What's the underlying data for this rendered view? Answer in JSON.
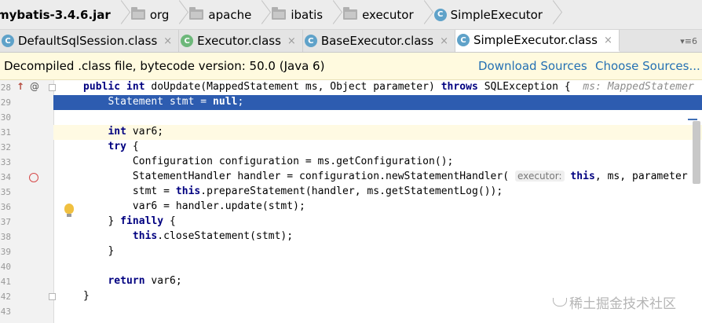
{
  "breadcrumb": {
    "items": [
      {
        "label": "mybatis-3.4.6.jar",
        "icon": "none"
      },
      {
        "label": "org",
        "icon": "folder-icon"
      },
      {
        "label": "apache",
        "icon": "folder-icon"
      },
      {
        "label": "ibatis",
        "icon": "folder-icon"
      },
      {
        "label": "executor",
        "icon": "folder-icon"
      },
      {
        "label": "SimpleExecutor",
        "icon": "class-icon"
      }
    ]
  },
  "tabs": {
    "items": [
      {
        "label": "DefaultSqlSession.class",
        "close": "×"
      },
      {
        "label": "Executor.class",
        "close": "×"
      },
      {
        "label": "BaseExecutor.class",
        "close": "×"
      },
      {
        "label": "SimpleExecutor.class",
        "close": "×"
      }
    ],
    "overflow_count": "6",
    "class_icon_letter": "C"
  },
  "banner": {
    "text": "Decompiled .class file, bytecode version: 50.0 (Java 6)",
    "download_sources": "Download Sources",
    "choose_sources": "Choose Sources..."
  },
  "editor": {
    "lines": [
      {
        "num": "28"
      },
      {
        "num": "29"
      },
      {
        "num": "30"
      },
      {
        "num": "31"
      },
      {
        "num": "32"
      },
      {
        "num": "33"
      },
      {
        "num": "34"
      },
      {
        "num": "35"
      },
      {
        "num": "36"
      },
      {
        "num": "37"
      },
      {
        "num": "38"
      },
      {
        "num": "39"
      },
      {
        "num": "40"
      },
      {
        "num": "41"
      },
      {
        "num": "42"
      },
      {
        "num": "43"
      }
    ],
    "tokens": {
      "l28_kw1": "public int",
      "l28_a": " doUpdate(MappedStatement ms, Object parameter) ",
      "l28_kw2": "throws",
      "l28_b": " SQLException {  ",
      "l28_hint": "ms: MappedStatemer",
      "l29_a": "Statement stmt = ",
      "l29_kw": "null",
      "l29_b": ";",
      "l31_kw": "int",
      "l31_a": " var6;",
      "l32_kw": "try",
      "l32_a": " {",
      "l33_a": "Configuration configuration = ms.getConfiguration();",
      "l34_a": "StatementHandler handler = configuration.newStatementHandler( ",
      "l34_hint": "executor:",
      "l34_kw": " this",
      "l34_b": ", ms, parameter",
      "l35_a": "stmt = ",
      "l35_kw": "this",
      "l35_b": ".prepareStatement(handler, ms.getStatementLog());",
      "l36_a": "var6 = handler.update(stmt);",
      "l37_a": "} ",
      "l37_kw": "finally",
      "l37_b": " {",
      "l38_kw": "this",
      "l38_a": ".closeStatement(stmt);",
      "l39_a": "}",
      "l41_kw": "return",
      "l41_a": " var6;",
      "l42_a": "}"
    },
    "gutter_icons": {
      "override": "↑",
      "annotation": "@"
    }
  },
  "watermark": "稀土掘金技术社区",
  "colors": {
    "selection": "#2d5cb0",
    "banner_bg": "#fffadf",
    "link": "#2470b3",
    "keyword": "#000080"
  }
}
